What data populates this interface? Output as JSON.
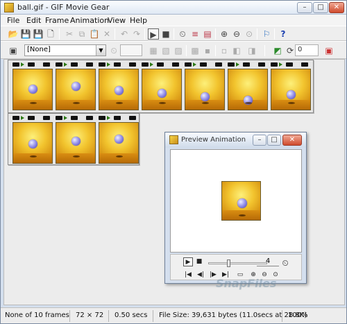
{
  "window": {
    "title": "ball.gif - GIF Movie Gear",
    "min_label": "–",
    "max_label": "□",
    "close_label": "✕"
  },
  "menu": [
    "File",
    "Edit",
    "Frame",
    "Animation",
    "View",
    "Help"
  ],
  "toolbar1": {
    "open_icon": "📂",
    "save_icon": "💾",
    "new_icon": "🗋",
    "cut_icon": "✂",
    "copy_icon": "⧉",
    "paste_icon": "📋",
    "delete_icon": "✕",
    "undo_icon": "↶",
    "redo_icon": "↷",
    "play_icon": "▶",
    "stop_icon": "■",
    "timing_icon": "⏲",
    "optimize_icon": "≡",
    "palette_icon": "▤",
    "zoom_in_icon": "⊕",
    "zoom_out_icon": "⊖",
    "zoom_fit_icon": "⊙",
    "marker_icon": "⚐",
    "help_icon": "?"
  },
  "toolbar2": {
    "frame_select_icon": "▣",
    "combo_value": "[None]",
    "combo_arrow": "▼",
    "delay_icon": "⏲",
    "delay_value": "",
    "loop_icon": "⟳",
    "loop_value": "0",
    "t2_icons": [
      "▦",
      "▧",
      "▨",
      "▩",
      "▪",
      "▫",
      "◧",
      "◨",
      "◩"
    ]
  },
  "frames_total": 10,
  "preview": {
    "title": "Preview Animation",
    "frame_number": "4",
    "slider_position": 0.33,
    "play_icon": "▶",
    "stop_icon": "■",
    "first_icon": "|◀",
    "prev_icon": "◀|",
    "next_icon": "|▶",
    "last_icon": "▶|",
    "screen_icon": "▭",
    "zoom_in_icon": "⊕",
    "zoom_out_icon": "⊖",
    "zoom_fit_icon": "⊙",
    "timer_icon": "⏲"
  },
  "watermark": "SnapFiles",
  "status": {
    "frames": "None of 10 frames",
    "dimensions": "72 × 72",
    "delay": "0.50 secs",
    "filesize": "File Size: 39,631 bytes  (11.0secs at 28.8K)",
    "zoom": "100%"
  }
}
